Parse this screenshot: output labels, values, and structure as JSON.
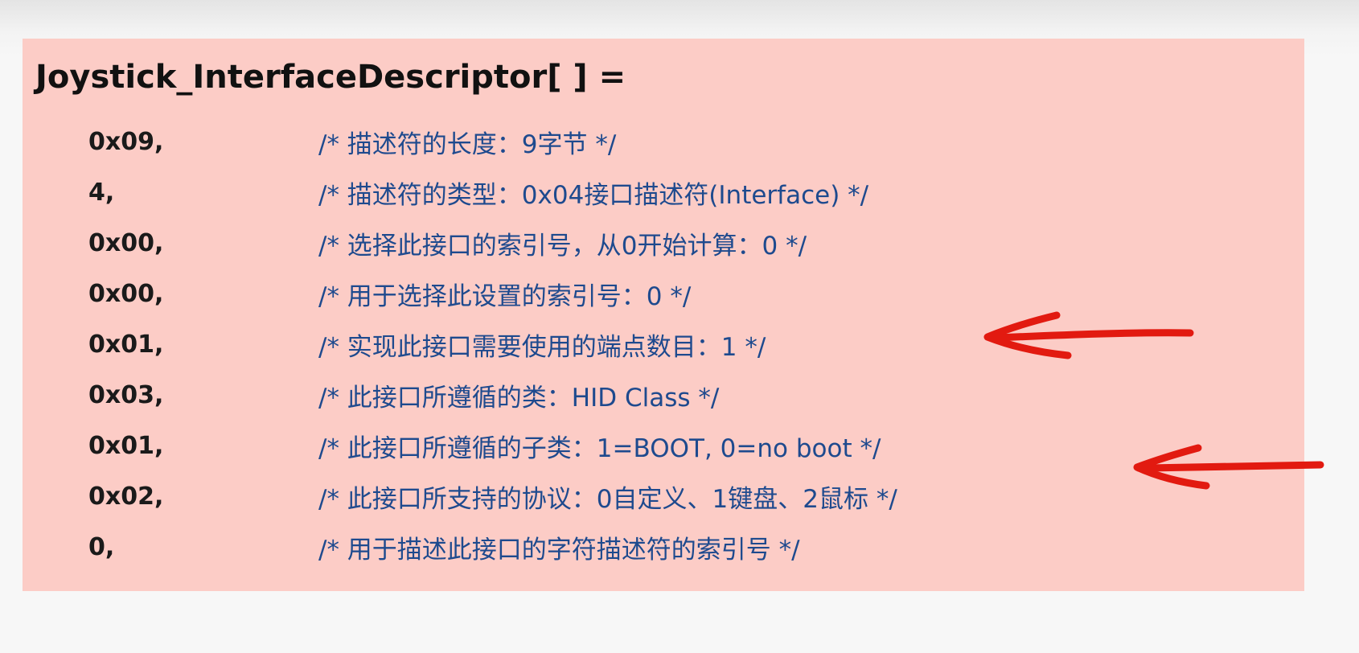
{
  "title": "Joystick_InterfaceDescriptor[ ] =",
  "rows": [
    {
      "value": "0x09,",
      "comment": "/* 描述符的长度：9字节 */"
    },
    {
      "value": "4,",
      "comment": "/* 描述符的类型：0x04接口描述符(Interface) */"
    },
    {
      "value": "0x00,",
      "comment": "/* 选择此接口的索引号，从0开始计算：0 */"
    },
    {
      "value": "0x00,",
      "comment": "/* 用于选择此设置的索引号：0 */"
    },
    {
      "value": "0x01,",
      "comment": "/* 实现此接口需要使用的端点数目：1 */"
    },
    {
      "value": "0x03,",
      "comment": "/* 此接口所遵循的类：HID Class */"
    },
    {
      "value": "0x01,",
      "comment": "/* 此接口所遵循的子类：1=BOOT, 0=no boot */"
    },
    {
      "value": "0x02,",
      "comment": "/* 此接口所支持的协议：0自定义、1键盘、2鼠标 */"
    },
    {
      "value": "0,",
      "comment": "/* 用于描述此接口的字符描述符的索引号 */"
    }
  ],
  "colors": {
    "box_background": "#fcccc6",
    "title_text": "#111111",
    "value_text": "#1a1a1a",
    "comment_text": "#1e4a8e",
    "arrow": "#e21a10"
  },
  "annotations": [
    {
      "icon": "left-arrow-icon",
      "points_to_row": 4
    },
    {
      "icon": "left-arrow-icon",
      "points_to_row": 7
    }
  ]
}
